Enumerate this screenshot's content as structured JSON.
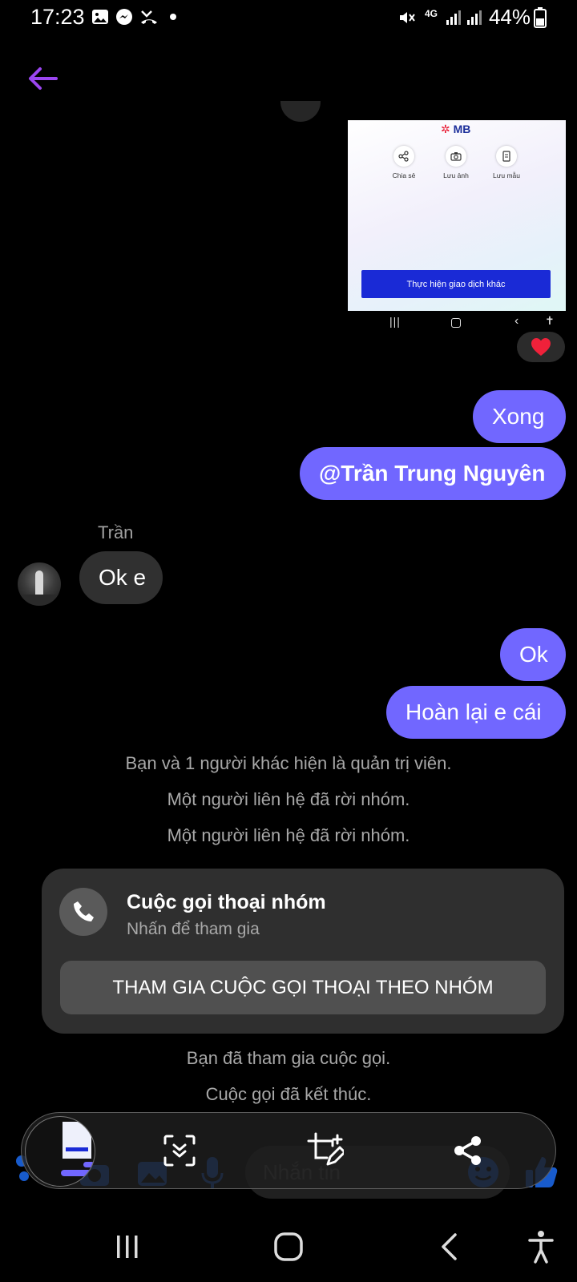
{
  "status_bar": {
    "time": "17:23",
    "network": "4G",
    "battery": "44%",
    "icons": [
      "image-icon",
      "messenger-icon",
      "missed-call-icon",
      "dot-icon",
      "mute-icon",
      "signal-icon",
      "battery-icon"
    ]
  },
  "header": {
    "back_icon": "arrow-left-icon",
    "accent_color": "#9b46f0"
  },
  "shared_image": {
    "logo": "MB",
    "actions": [
      {
        "label": "Chia sẻ",
        "icon": "share-icon"
      },
      {
        "label": "Lưu ảnh",
        "icon": "camera-icon"
      },
      {
        "label": "Lưu mẫu",
        "icon": "document-icon"
      }
    ],
    "cta": "Thực hiện giao dịch khác",
    "reaction": "❤️"
  },
  "messages": {
    "out1": "Xong",
    "out2": "@Trần Trung Nguyên",
    "sender": "Trần",
    "in1": "Ok e",
    "out3": "Ok",
    "out4": "Hoàn lại e cái"
  },
  "system_messages": [
    "Bạn và 1 người khác hiện là quản trị viên.",
    "Một người liên hệ đã rời nhóm.",
    "Một người liên hệ đã rời nhóm."
  ],
  "call_card": {
    "title": "Cuộc gọi thoại nhóm",
    "subtitle": "Nhấn để tham gia",
    "join_label": "THAM GIA CUỘC GỌI THOẠI THEO NHÓM"
  },
  "system_messages_after": [
    "Bạn đã tham gia cuộc gọi.",
    "Cuộc gọi đã kết thúc."
  ],
  "composer": {
    "placeholder": "Nhắn tin"
  },
  "capture_toolbar": {
    "tools": [
      "scroll-capture-icon",
      "crop-edit-icon",
      "share-icon"
    ]
  },
  "colors": {
    "outgoing_bubble": "#7167ff",
    "incoming_bubble": "#303030",
    "background": "#000000"
  }
}
